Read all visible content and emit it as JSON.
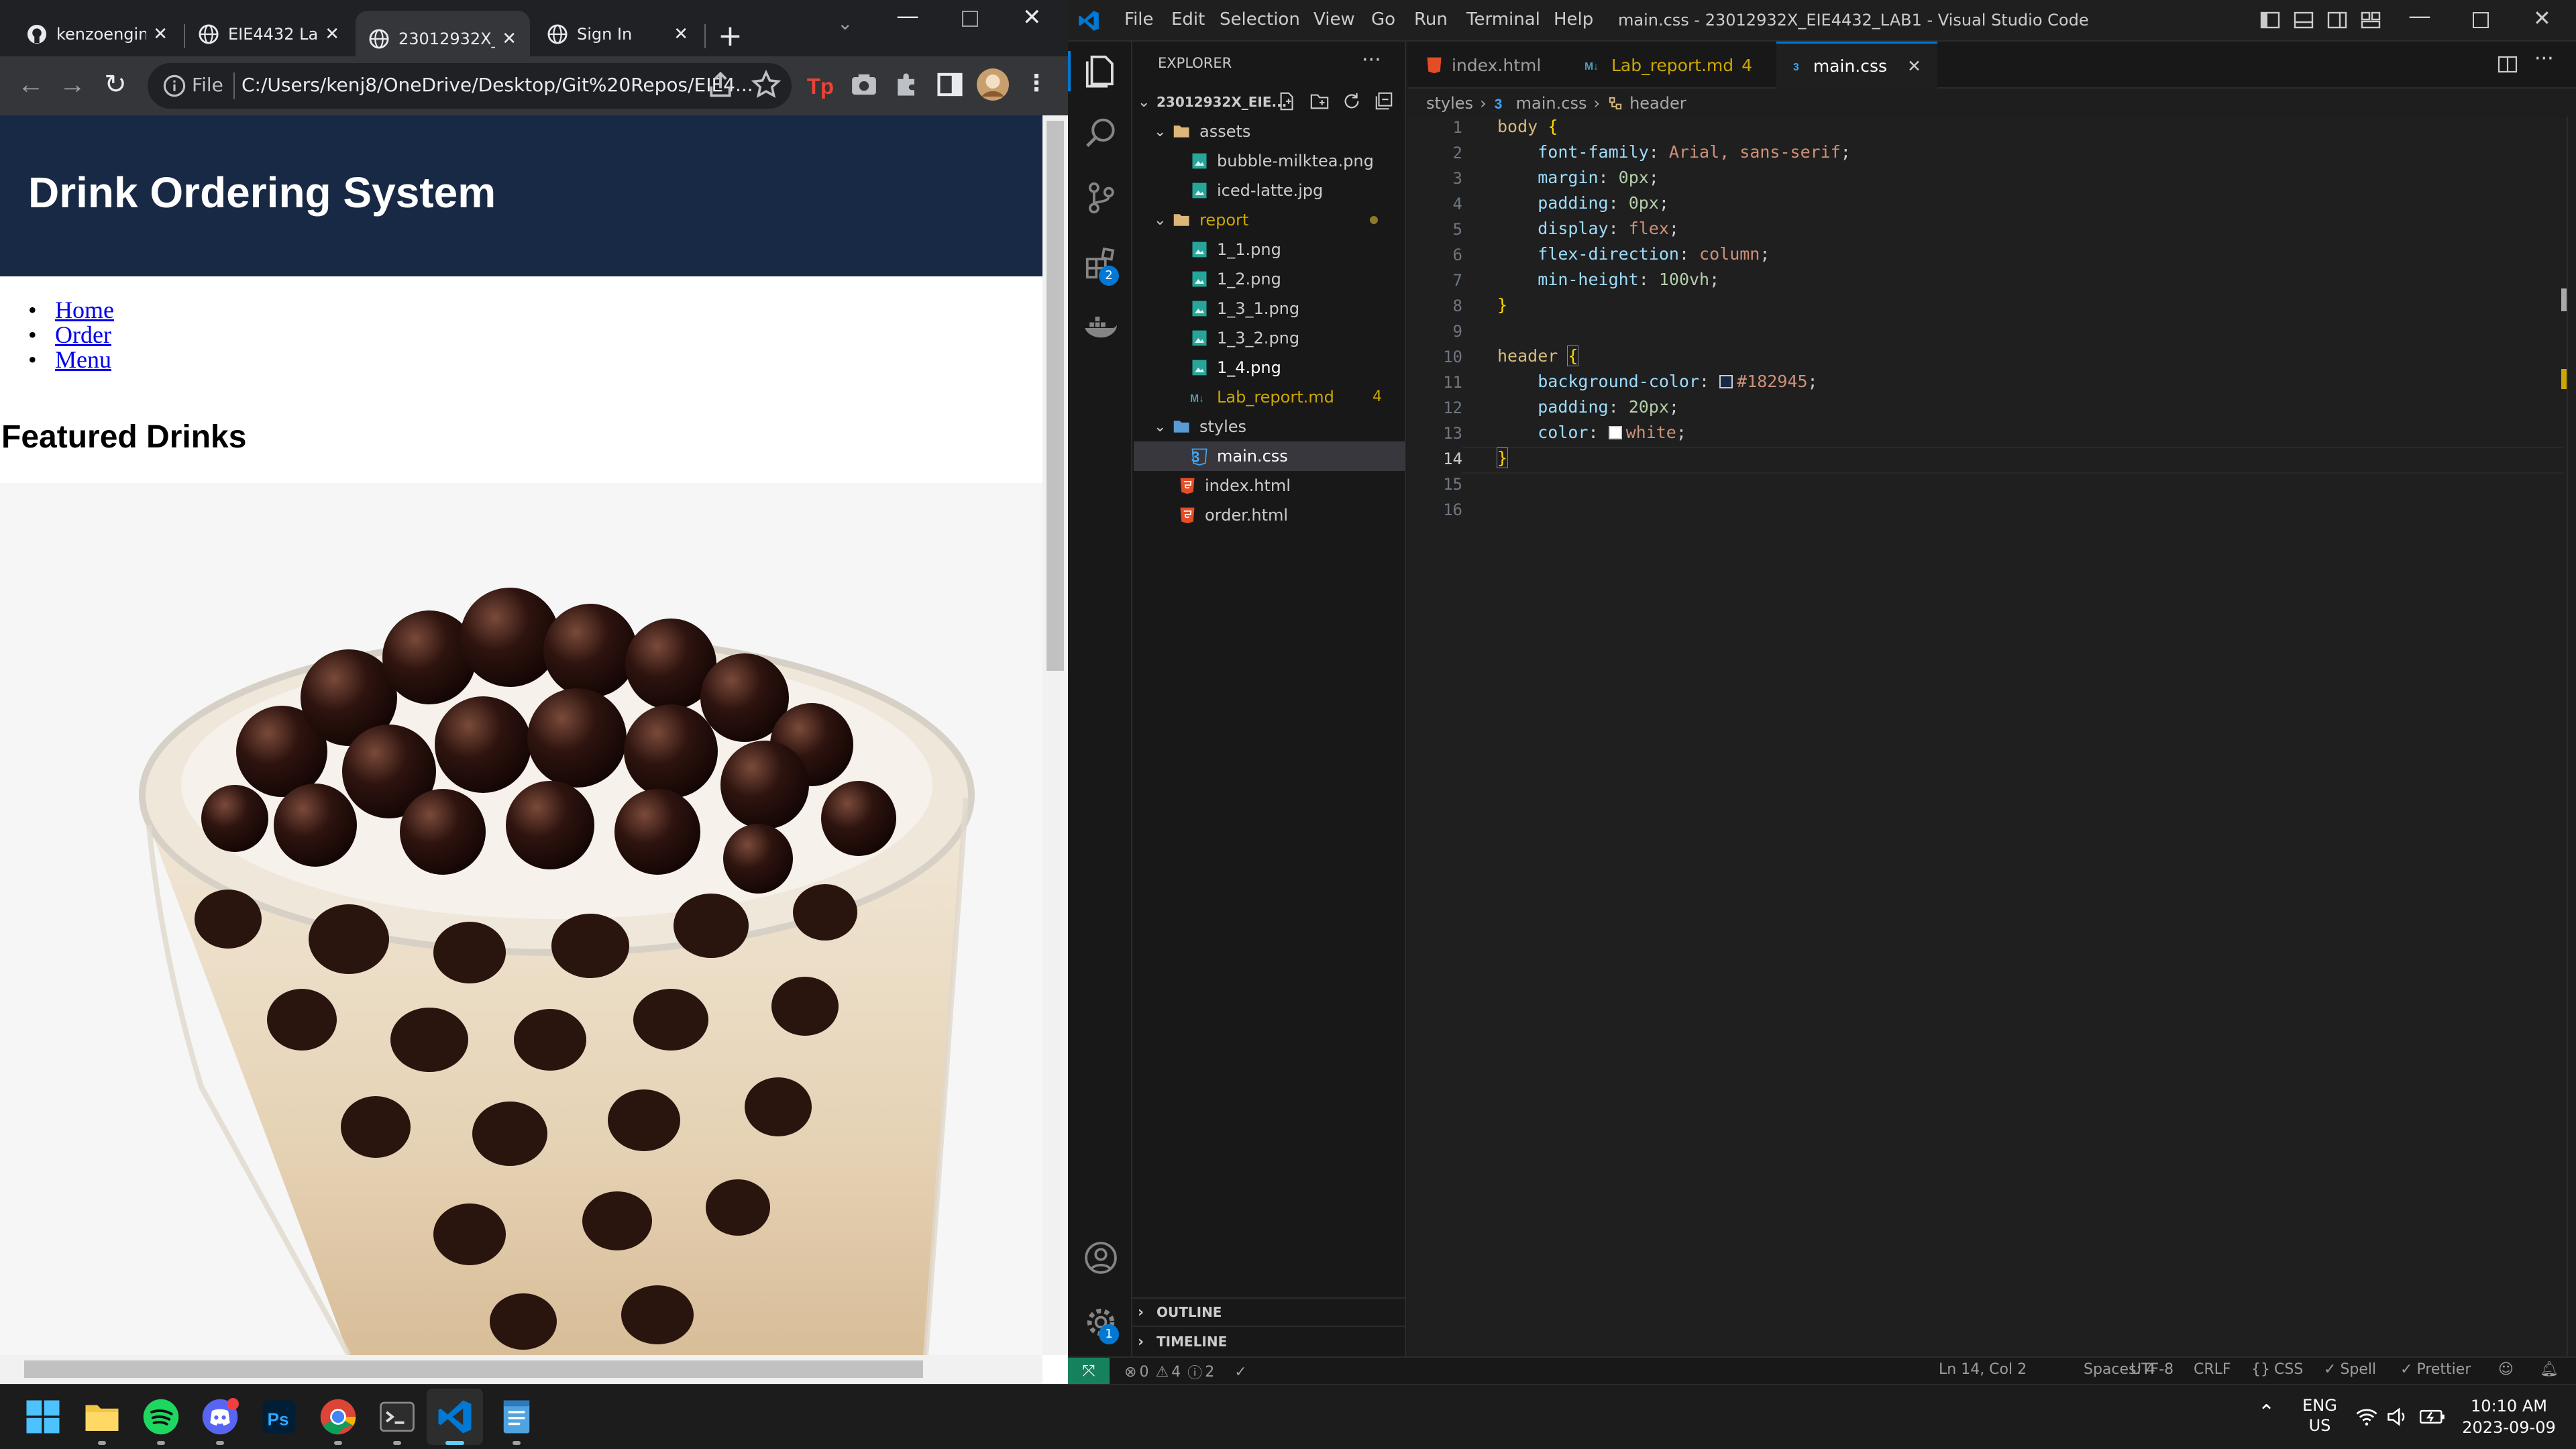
{
  "browser": {
    "tabs": [
      {
        "label": "kenzoengin"
      },
      {
        "label": "EIE4432 Lab"
      },
      {
        "label": "23012932X_"
      },
      {
        "label": "Sign In"
      }
    ],
    "address": {
      "scheme_label": "File",
      "url": "C:/Users/kenj8/OneDrive/Desktop/Git%20Repos/EIE4..."
    },
    "page": {
      "header_title": "Drink Ordering System",
      "nav": [
        "Home",
        "Order",
        "Menu"
      ],
      "section_heading": "Featured Drinks",
      "image_name": "bubble-milktea.png"
    }
  },
  "vscode": {
    "menu": [
      "File",
      "Edit",
      "Selection",
      "View",
      "Go",
      "Run",
      "Terminal",
      "Help"
    ],
    "window_title": "main.css - 23012932X_EIE4432_LAB1 - Visual Studio Code",
    "explorer": {
      "title": "EXPLORER",
      "root": "23012932X_EIE...",
      "items": [
        {
          "label": "assets",
          "kind": "folder"
        },
        {
          "label": "bubble-milktea.png",
          "kind": "image"
        },
        {
          "label": "iced-latte.jpg",
          "kind": "image"
        },
        {
          "label": "report",
          "kind": "folder"
        },
        {
          "label": "1_1.png",
          "kind": "image"
        },
        {
          "label": "1_2.png",
          "kind": "image"
        },
        {
          "label": "1_3_1.png",
          "kind": "image"
        },
        {
          "label": "1_3_2.png",
          "kind": "image"
        },
        {
          "label": "1_4.png",
          "kind": "image"
        },
        {
          "label": "Lab_report.md",
          "kind": "markdown",
          "badge": "4"
        },
        {
          "label": "styles",
          "kind": "folder"
        },
        {
          "label": "main.css",
          "kind": "css"
        },
        {
          "label": "index.html",
          "kind": "html"
        },
        {
          "label": "order.html",
          "kind": "html"
        }
      ],
      "outline": "OUTLINE",
      "timeline": "TIMELINE"
    },
    "activity_badges": {
      "extensions": "2",
      "settings": "1"
    },
    "editor_tabs": [
      {
        "label": "index.html"
      },
      {
        "label": "Lab_report.md",
        "badge": "4"
      },
      {
        "label": "main.css"
      }
    ],
    "breadcrumb": {
      "folder": "styles",
      "file": "main.css",
      "symbol": "header"
    },
    "code": {
      "line_numbers": [
        "1",
        "2",
        "3",
        "4",
        "5",
        "6",
        "7",
        "8",
        "9",
        "10",
        "11",
        "12",
        "13",
        "14",
        "15",
        "16"
      ],
      "l1_sel": "body",
      "l2_prop": "font-family",
      "l2_val": "Arial, sans-serif",
      "l3_prop": "margin",
      "l3_val": "0px",
      "l4_prop": "padding",
      "l4_val": "0px",
      "l5_prop": "display",
      "l5_val": "flex",
      "l6_prop": "flex-direction",
      "l6_val": "column",
      "l7_prop": "min-height",
      "l7_val": "100vh",
      "l10_sel": "header",
      "l11_prop": "background-color",
      "l11_val": "#182945",
      "l12_prop": "padding",
      "l12_val": "20px",
      "l13_prop": "color",
      "l13_val": "white"
    },
    "status": {
      "errors": "0",
      "warnings": "4",
      "infos": "2",
      "position": "Ln 14, Col 2",
      "spaces": "Spaces: 4",
      "encoding": "UTF-8",
      "eol": "CRLF",
      "language": "CSS",
      "spell": "Spell",
      "prettier": "Prettier"
    }
  },
  "taskbar": {
    "language": "ENG",
    "region": "US",
    "time": "10:10 AM",
    "date": "2023-09-09"
  },
  "colors": {
    "header_bg": "#182945",
    "accent": "#0078d4"
  }
}
